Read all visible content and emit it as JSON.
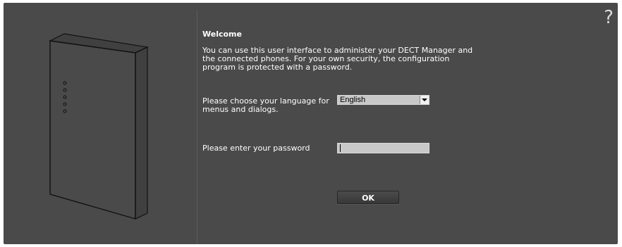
{
  "welcome": {
    "title": "Welcome",
    "intro": "You can use this user interface to administer your DECT Manager and the connected phones. For your own security, the configuration program is protected with a password."
  },
  "language": {
    "label": "Please choose your language for menus and dialogs.",
    "selected": "English"
  },
  "password": {
    "label": "Please enter your password",
    "value": ""
  },
  "actions": {
    "ok_label": "OK"
  },
  "help": {
    "symbol": "?"
  },
  "colors": {
    "background": "#4a4a4a",
    "text": "#ffffff",
    "field": "#c8c8c8"
  },
  "icons": {
    "device": "dect-manager-device-illustration",
    "help": "help-icon",
    "dropdown": "chevron-down-icon"
  }
}
